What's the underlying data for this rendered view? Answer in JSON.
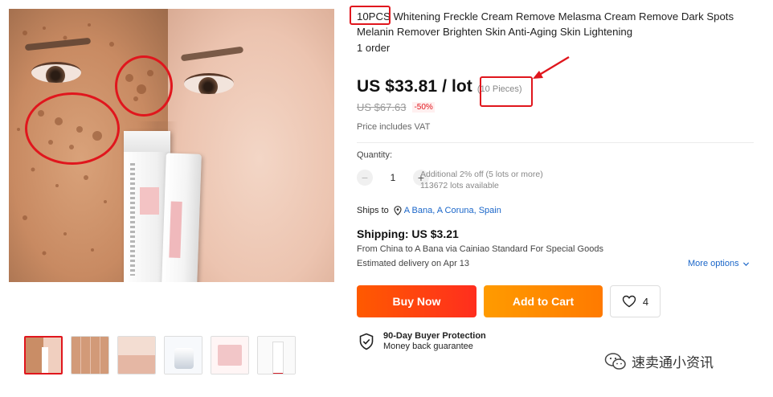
{
  "product": {
    "title_tag": "10PCS",
    "title_rest": " Whitening Freckle Cream Remove Melasma Cream Remove Dark Spots Melanin Remover Brighten Skin Anti-Aging Skin Lightening",
    "orders": "1 order"
  },
  "price": {
    "current": "US $33.81 / lot",
    "pieces": "(10 Pieces)",
    "original": "US $67.63",
    "discount": "-50%",
    "vat_note": "Price includes VAT"
  },
  "quantity": {
    "label": "Quantity:",
    "minus": "−",
    "value": "1",
    "plus": "+",
    "discount_note": "Additional 2% off (5 lots or more)",
    "available": "113672 lots available"
  },
  "shipping": {
    "ships_to_label": "Ships to",
    "destination": "A Bana, A Coruna, Spain",
    "cost": "Shipping: US $3.21",
    "from_line": "From China to A Bana via Cainiao Standard For Special Goods",
    "delivery": "Estimated delivery on Apr 13",
    "more_options": "More options"
  },
  "actions": {
    "buy_now": "Buy Now",
    "add_to_cart": "Add to Cart",
    "wishlist_count": "4"
  },
  "protection": {
    "title": "90-Day Buyer Protection",
    "subtitle": "Money back guarantee"
  },
  "watermark": {
    "text": "速卖通小资讯"
  },
  "colors": {
    "accent_red": "#e0161d",
    "buy_now": "#ff4a0f",
    "add_to_cart": "#ff8c00",
    "link_blue": "#1a66c9"
  },
  "icons": [
    "location-pin-icon",
    "chevron-down-icon",
    "heart-icon",
    "shield-check-icon",
    "wechat-icon"
  ]
}
